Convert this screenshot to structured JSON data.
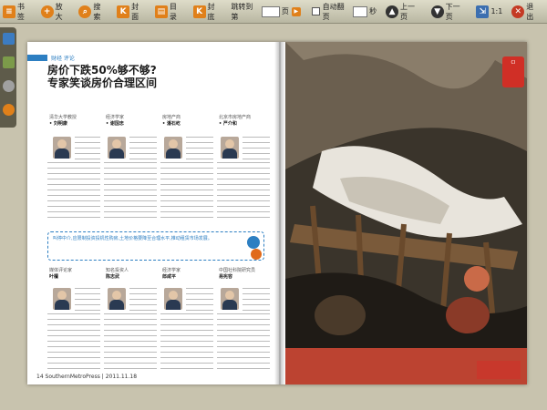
{
  "toolbar": {
    "bookmark": "书签",
    "zoom_in": "放大",
    "search": "搜索",
    "cover": "封面",
    "toc": "目录",
    "back_cover": "封底",
    "jump_label": "跳转到第",
    "page_unit": "页",
    "auto_flip": "自动翻页",
    "seconds_unit": "秒",
    "prev": "上一页",
    "next": "下一页",
    "ratio": "1:1",
    "exit": "退出"
  },
  "magazine": {
    "section": "财经 评论",
    "headline_1": "房价下跌50%够不够?",
    "headline_2": "专家笑谈房价合理区间",
    "experts_top": [
      {
        "role": "清华大学教授",
        "name": "• 刘明康"
      },
      {
        "role": "经济学家",
        "name": "• 谢国忠"
      },
      {
        "role": "房地产商",
        "name": "• 潘石屹"
      },
      {
        "role": "北京市房地产商",
        "name": "• 严介和"
      }
    ],
    "experts_bottom": [
      {
        "role": "媒体评论家",
        "name": "叶檀"
      },
      {
        "role": "知名投资人",
        "name": "陈志武"
      },
      {
        "role": "经济学家",
        "name": "郎咸平"
      },
      {
        "role": "中国社科院研究员",
        "name": "易宪容"
      }
    ],
    "callout": "叫停中介,应限制投资投机性购房,土地价格要降至合理水平,推动租赁市场发展。",
    "footer": "14  SouthernMetroPress | 2011.11.18"
  },
  "colors": {
    "accent": "#2d7fc2",
    "badge": "#d02f26",
    "toolbar": "#cfcdb9"
  }
}
